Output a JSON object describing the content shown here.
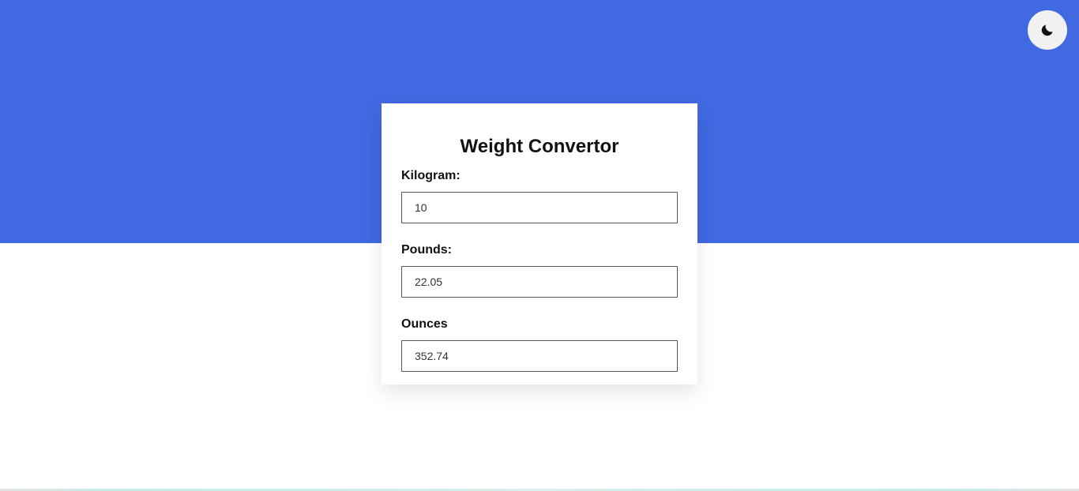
{
  "theme_toggle": {
    "icon": "moon-icon",
    "aria_label": ""
  },
  "colors": {
    "hero": "#4169e1",
    "card": "#ffffff",
    "text": "#111111"
  },
  "converter": {
    "title": "Weight Convertor",
    "fields": [
      {
        "label": "Kilogram:",
        "value": "10"
      },
      {
        "label": "Pounds:",
        "value": "22.05"
      },
      {
        "label": "Ounces",
        "value": "352.74"
      }
    ]
  }
}
